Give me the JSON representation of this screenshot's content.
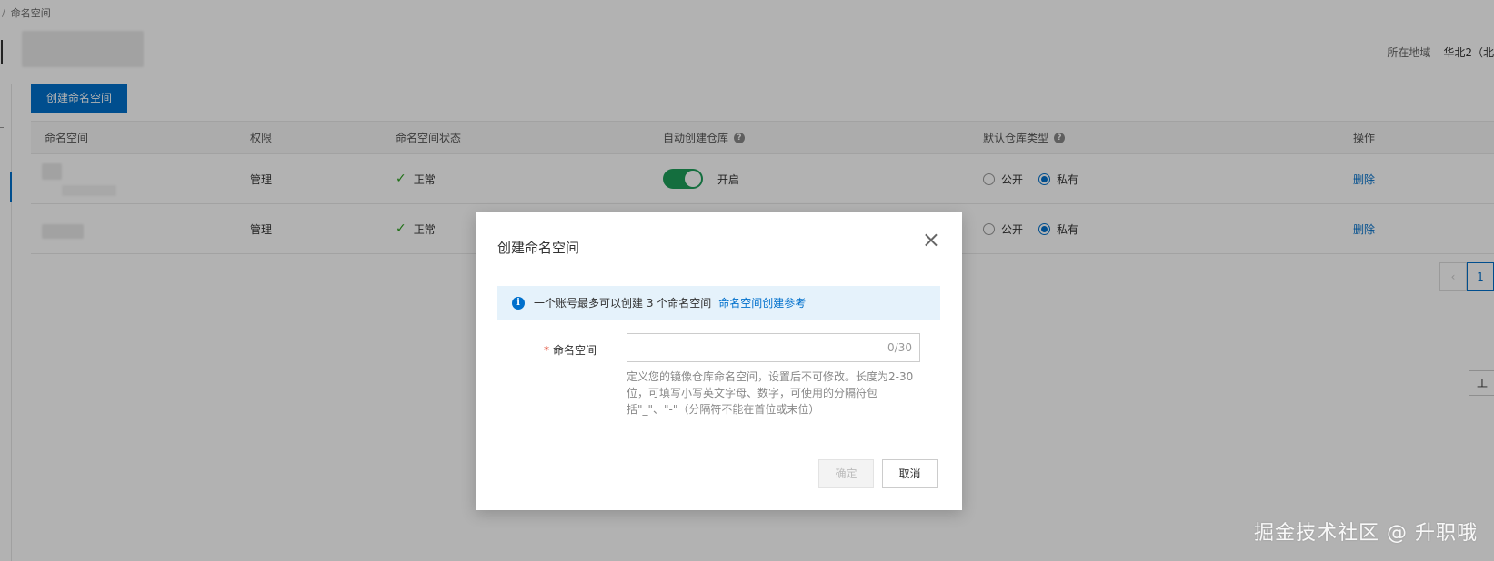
{
  "breadcrumb": {
    "separator": "/",
    "current": "命名空间"
  },
  "header": {
    "region_label": "所在地域",
    "region_value": "华北2（北"
  },
  "toolbar": {
    "create_label": "创建命名空间"
  },
  "table": {
    "columns": [
      "命名空间",
      "权限",
      "命名空间状态",
      "自动创建仓库",
      "默认仓库类型",
      "操作"
    ],
    "rows": [
      {
        "permission": "管理",
        "status": "正常",
        "auto_create": "开启",
        "radio_public": "公开",
        "radio_private": "私有",
        "selected": "私有",
        "action": "删除"
      },
      {
        "permission": "管理",
        "status": "正常",
        "auto_create": "",
        "radio_public": "公开",
        "radio_private": "私有",
        "selected": "私有",
        "action": "删除"
      }
    ]
  },
  "pagination": {
    "prev": "‹",
    "current": "1"
  },
  "side_tab": {
    "label": "工具"
  },
  "dialog": {
    "title": "创建命名空间",
    "close": "×",
    "notice_text": "一个账号最多可以创建 3 个命名空间",
    "notice_link": "命名空间创建参考",
    "field_label": "命名空间",
    "field_required": "*",
    "field_value": "",
    "field_counter": "0/30",
    "help_text": "定义您的镜像仓库命名空间，设置后不可修改。长度为2-30位，可填写小写英文字母、数字，可使用的分隔符包括\"_\"、\"-\"（分隔符不能在首位或末位）",
    "ok_label": "确定",
    "cancel_label": "取消"
  },
  "watermark": "掘金技术社区 @ 升职哦",
  "colors": {
    "primary": "#0070cc",
    "success": "#2ea121",
    "toggle_on": "#1e9e5a",
    "mask": "rgba(0,0,0,0.3)"
  }
}
